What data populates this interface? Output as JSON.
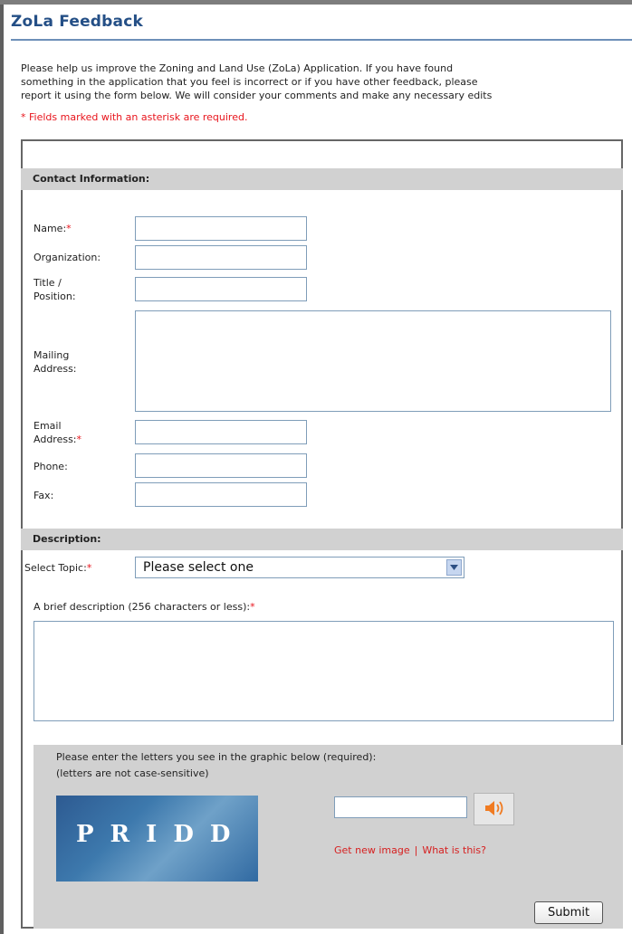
{
  "page": {
    "title": "ZoLa Feedback",
    "intro_lines": [
      "Please help us improve the Zoning and Land Use (ZoLa) Application. If you have found",
      "something in the application that you feel is incorrect or if you have other feedback, please",
      "report it using the form below. We will consider your comments and make any necessary edits"
    ],
    "required_note": "* Fields marked with an asterisk are required."
  },
  "contact": {
    "heading": "Contact Information:",
    "name_label": "Name:",
    "organization_label": "Organization:",
    "title_label_line1": "Title /",
    "title_label_line2": "Position:",
    "mailing_label_line1": "Mailing",
    "mailing_label_line2": "Address:",
    "email_label_line1": "Email",
    "email_label_line2": "Address:",
    "phone_label": "Phone:",
    "fax_label": "Fax:",
    "asterisk": "*"
  },
  "description": {
    "heading": "Description:",
    "topic_label": "Select Topic:",
    "topic_value": "Please select one",
    "brief_label": "A brief description (256 characters or less):"
  },
  "captcha": {
    "instruction_line1": "Please enter the letters you see in the graphic below (required):",
    "instruction_line2": "(letters are not case-sensitive)",
    "letters": "PRIDD",
    "new_image_link": "Get new image",
    "separator": "|",
    "what_is_this_link": "What is this?",
    "audio_icon": "speaker-icon"
  },
  "actions": {
    "submit_label": "Submit"
  },
  "colors": {
    "title": "#244f86",
    "required": "#e8141c",
    "section_bg": "#d1d1d1",
    "input_border": "#7f9db9"
  }
}
